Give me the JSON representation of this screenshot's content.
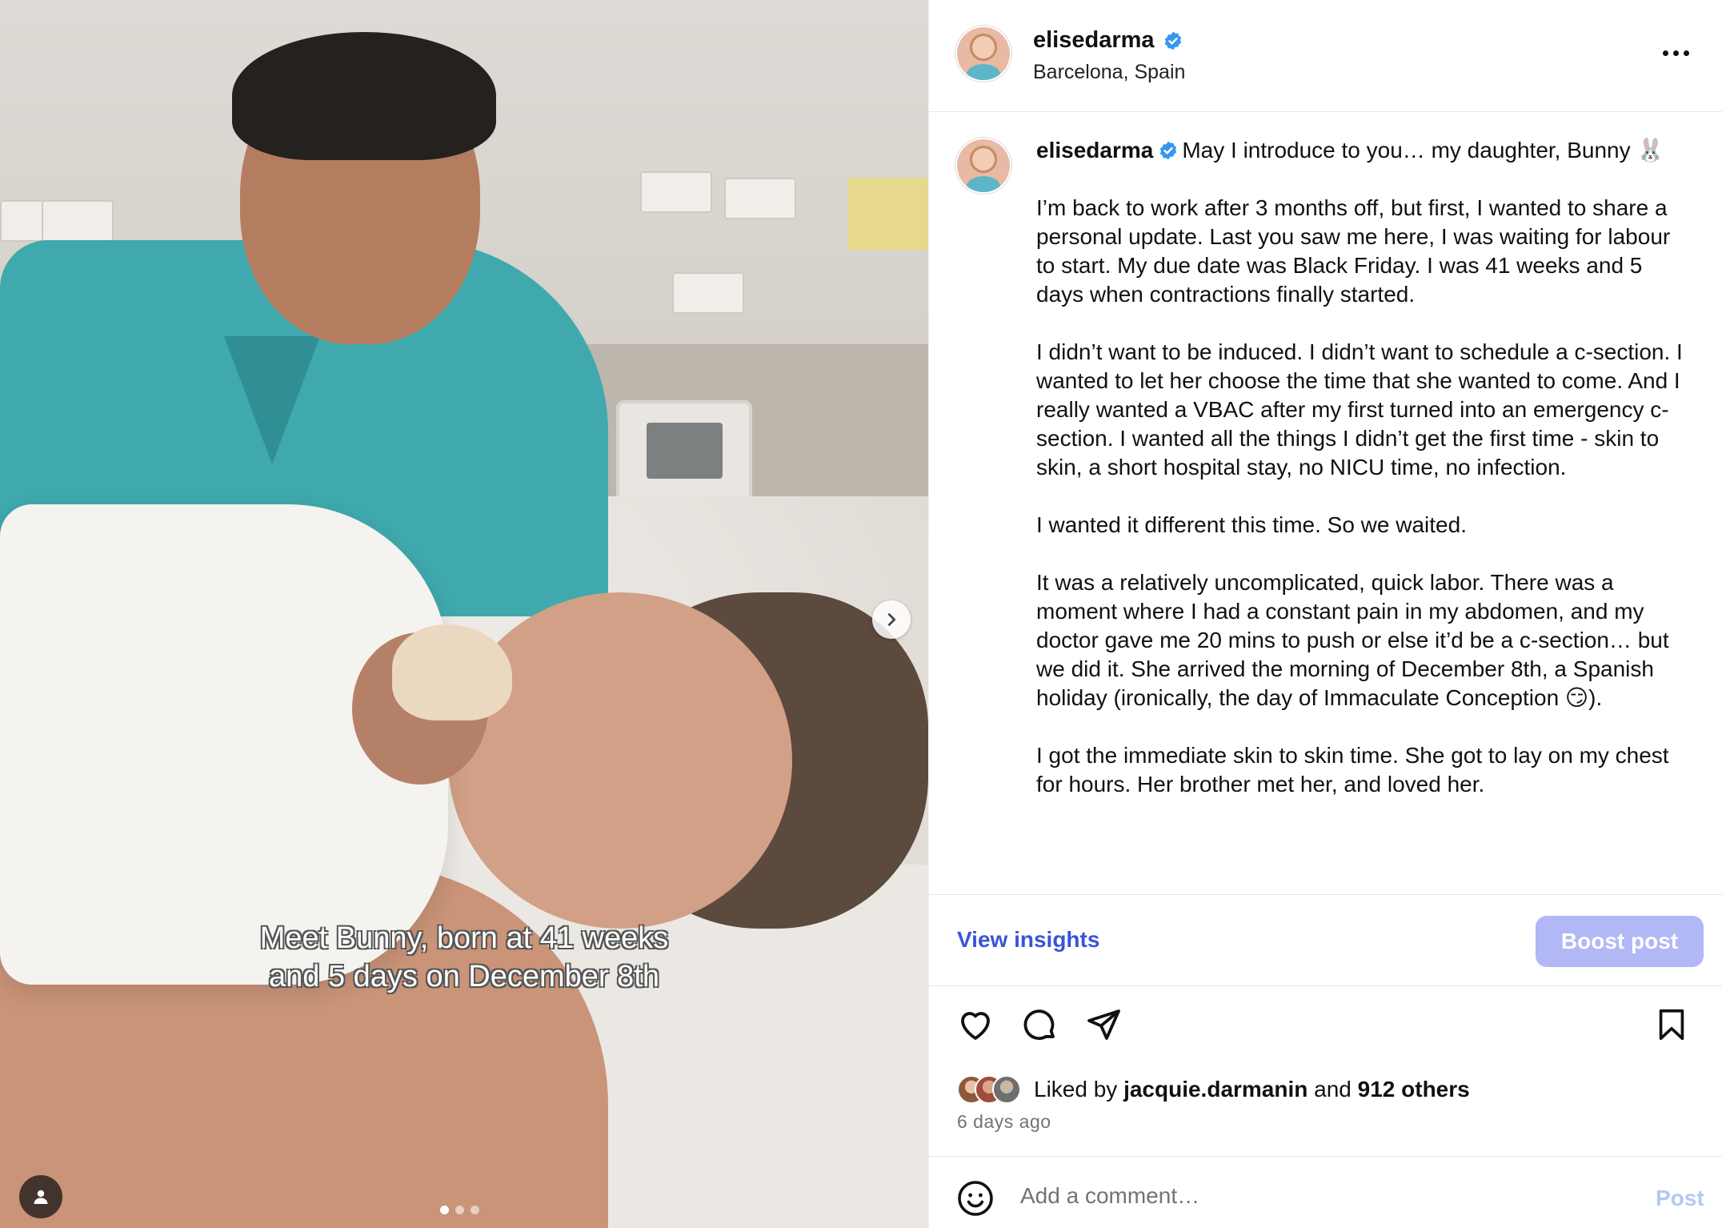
{
  "media": {
    "overlay_text": "Meet Bunny, born at 41 weeks\nand 5 days on December 8th",
    "carousel": {
      "count": 3,
      "active_index": 0
    },
    "icons": {
      "next": "chevron-right-icon",
      "user_tag": "person-icon"
    }
  },
  "header": {
    "username": "elisedarma",
    "location": "Barcelona, Spain",
    "verified": true
  },
  "caption": {
    "username": "elisedarma",
    "first_line": "May I introduce to you… my daughter, Bunny 🐰",
    "paragraphs": [
      "I’m back to work after 3 months off, but first, I wanted to share a personal update. Last you saw me here, I was waiting for labour to start. My due date was Black Friday. I was 41 weeks and 5 days when contractions finally started.",
      "I didn’t want to be induced. I didn’t want to schedule a c-section. I wanted to let her choose the time that she wanted to come. And I really wanted a VBAC after my first turned into an emergency c-section. I wanted all the things I didn’t get the first time - skin to skin, a short hospital stay, no NICU time, no infection.",
      "I wanted it different this time. So we waited.",
      "It was a relatively uncomplicated, quick labor. There was a moment where I had a constant pain in my abdomen, and my doctor gave me 20 mins to push or else it’d be a c-section… but we did it. She arrived the morning of December 8th, a Spanish holiday (ironically, the day of Immaculate Conception 😏).",
      "I got the immediate skin to skin time. She got to lay on my chest for hours. Her brother met her, and loved her."
    ]
  },
  "actions": {
    "view_insights": "View insights",
    "boost_post": "Boost post",
    "boost_color": "#b2b7f5",
    "link_color": "#3b54d6"
  },
  "likes": {
    "prefix": "Liked by",
    "user": "jacquie.darmanin",
    "connector": "and",
    "others": "912 others"
  },
  "timestamp": "6 days ago",
  "comment": {
    "placeholder": "Add a comment…",
    "post_label": "Post"
  }
}
